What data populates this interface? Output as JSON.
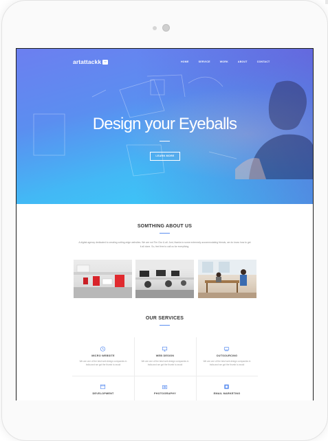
{
  "nav": {
    "logo": "artattackk",
    "logo_badge": "™",
    "items": [
      "HOME",
      "SERVICE",
      "WORK",
      "ABOUT",
      "CONTACT"
    ]
  },
  "hero": {
    "title": "Design your Eyeballs",
    "button": "LEARN MORE"
  },
  "about": {
    "title": "SOMTHING ABOUT US",
    "text": "A digital agency dedicated to creating cutting-edge websites. We are not Tim Cko & all. Just, thanks to some extremely accommodating friends, we do know how to get it all done. So, feel free to call us for everything."
  },
  "services": {
    "title": "OUR SERVICES",
    "items": [
      {
        "title": "MICRO WEBSITE",
        "icon": "clock-icon",
        "desc": "We are one of the best web design companies in India and we got the thumb to avoid"
      },
      {
        "title": "WEB DESIGN",
        "icon": "monitor-icon",
        "desc": "We are one of the best web design companies in India and we got the thumb to avoid"
      },
      {
        "title": "OUTSOURCING",
        "icon": "cloud-icon",
        "desc": "We are one of the best web design companies in India and we got the thumb to avoid"
      },
      {
        "title": "DEVELOPMENT",
        "icon": "code-icon",
        "desc": ""
      },
      {
        "title": "PHOTOGRAPHY",
        "icon": "camera-icon",
        "desc": ""
      },
      {
        "title": "EMAIL MARKETING",
        "icon": "mail-icon",
        "desc": ""
      }
    ]
  },
  "colors": {
    "accent": "#5b8ef0",
    "hero_start": "#6c7ff0",
    "hero_end": "#37d0f7"
  }
}
